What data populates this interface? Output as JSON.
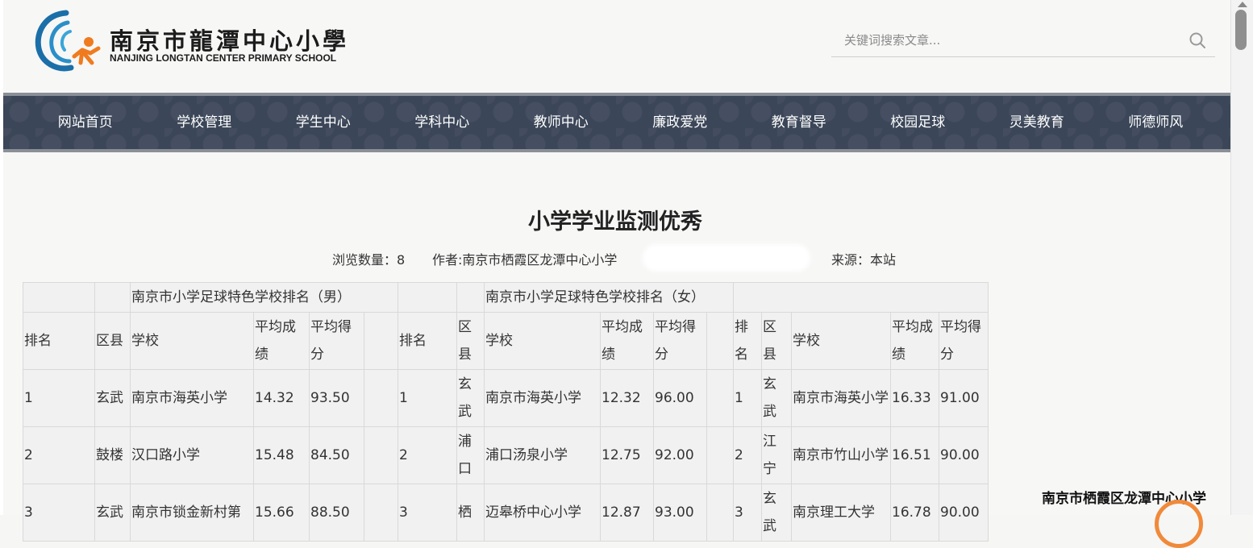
{
  "header": {
    "school_name_cn": "南京市龍潭中心小學",
    "school_name_en": "NANJING LONGTAN CENTER PRIMARY SCHOOL",
    "search_placeholder": "关键词搜索文章...",
    "search_icon": "search-icon"
  },
  "nav": {
    "items": [
      "网站首页",
      "学校管理",
      "学生中心",
      "学科中心",
      "教师中心",
      "廉政爱党",
      "教育督导",
      "校园足球",
      "灵美教育",
      "师德师风"
    ]
  },
  "article": {
    "title": "小学学业监测优秀",
    "views_label": "浏览数量：",
    "views": "8",
    "author_label": "作者:",
    "author": "南京市栖霞区龙潭中心小学",
    "source_label": "来源：",
    "source": "本站"
  },
  "table": {
    "group_titles": [
      "南京市小学足球特色学校排名（男）",
      "南京市小学足球特色学校排名（女）"
    ],
    "columns": [
      "排名",
      "区县",
      "学校",
      "平均成绩",
      "平均得分"
    ],
    "groups": [
      [
        [
          "1",
          "玄武",
          "南京市海英小学",
          "14.32",
          "93.50"
        ],
        [
          "2",
          "鼓楼",
          "汉口路小学",
          "15.48",
          "84.50"
        ],
        [
          "3",
          "玄武",
          "南京市锁金新村第",
          "15.66",
          "88.50"
        ]
      ],
      [
        [
          "1",
          "玄武",
          "南京市海英小学",
          "12.32",
          "96.00"
        ],
        [
          "2",
          "浦口",
          "浦口汤泉小学",
          "12.75",
          "92.00"
        ],
        [
          "3",
          "栖",
          "迈皋桥中心小学",
          "12.87",
          "93.00"
        ]
      ],
      [
        [
          "1",
          "玄武",
          "南京市海英小学",
          "16.33",
          "91.00"
        ],
        [
          "2",
          "江宁",
          "南京市竹山小学",
          "16.51",
          "90.00"
        ],
        [
          "3",
          "玄武",
          "南京理工大学",
          "16.78",
          "90.00"
        ]
      ]
    ]
  },
  "watermark": "南京市栖霞区龙潭中心小学",
  "colors": {
    "nav_bg": "#3b4658",
    "nav_border": "#8a9096",
    "page_bg": "#f7f7f6",
    "accent_orange": "#f08a3a",
    "logo_blue": "#1b6fa8"
  }
}
